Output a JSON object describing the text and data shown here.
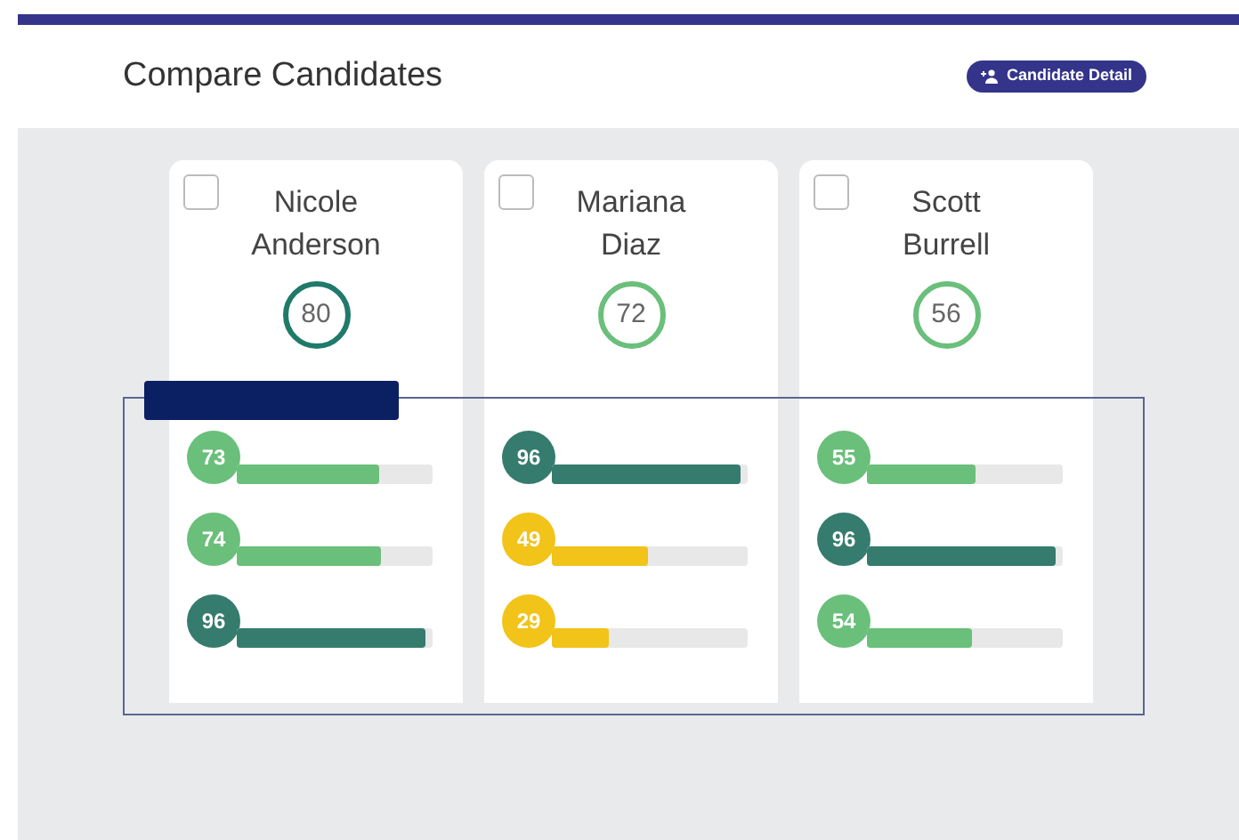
{
  "header": {
    "title": "Compare Candidates",
    "button": "Candidate Detail"
  },
  "candidates": [
    {
      "name": "Nicole Anderson",
      "checked": false,
      "score": "80",
      "color": "#1f7a6b",
      "metrics": [
        {
          "value": "73",
          "level": 0.73,
          "color": "#6abf7b"
        },
        {
          "value": "74",
          "level": 0.74,
          "color": "#6abf7b"
        },
        {
          "value": "96",
          "level": 0.96,
          "color": "#367c6e"
        }
      ]
    },
    {
      "name": "Mariana Diaz",
      "checked": false,
      "score": "72",
      "color": "#6abf7b",
      "metrics": [
        {
          "value": "96",
          "level": 0.96,
          "color": "#367c6e"
        },
        {
          "value": "49",
          "level": 0.49,
          "color": "#f2c318"
        },
        {
          "value": "29",
          "level": 0.29,
          "color": "#f2c318"
        }
      ]
    },
    {
      "name": "Scott Burrell",
      "checked": false,
      "score": "56",
      "color": "#6abf7b",
      "metrics": [
        {
          "value": "55",
          "level": 0.55,
          "color": "#6abf7b"
        },
        {
          "value": "96",
          "level": 0.96,
          "color": "#367c6e"
        },
        {
          "value": "54",
          "level": 0.54,
          "color": "#6abf7b"
        }
      ]
    }
  ]
}
